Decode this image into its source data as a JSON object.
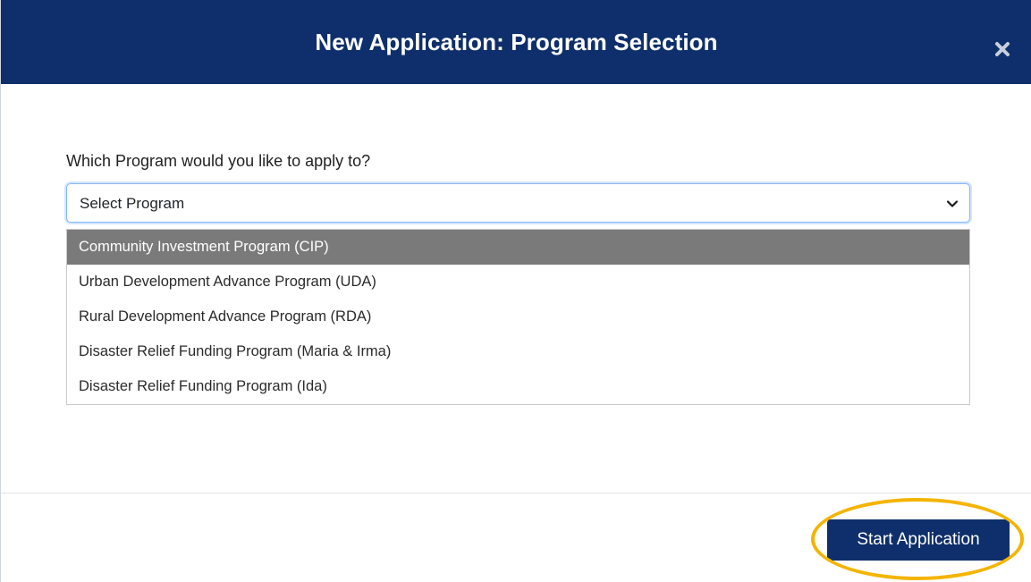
{
  "modal": {
    "title": "New Application: Program Selection",
    "close_icon": "close-icon"
  },
  "form": {
    "label": "Which Program would you like to apply to?",
    "select": {
      "value": "Select Program",
      "icon": "chevron-down-icon"
    },
    "options": [
      {
        "label": "Community Investment Program (CIP)",
        "highlighted": true
      },
      {
        "label": "Urban Development Advance Program (UDA)",
        "highlighted": false
      },
      {
        "label": "Rural Development Advance Program (RDA)",
        "highlighted": false
      },
      {
        "label": "Disaster Relief Funding Program (Maria & Irma)",
        "highlighted": false
      },
      {
        "label": "Disaster Relief Funding Program (Ida)",
        "highlighted": false
      }
    ]
  },
  "footer": {
    "start_label": "Start Application"
  },
  "colors": {
    "header_bg": "#0e2f6b",
    "button_bg": "#0e2f6b",
    "highlight_option": "#7a7a7a",
    "annotation_ring": "#f4b400",
    "select_focus_border": "#86b7fe"
  }
}
